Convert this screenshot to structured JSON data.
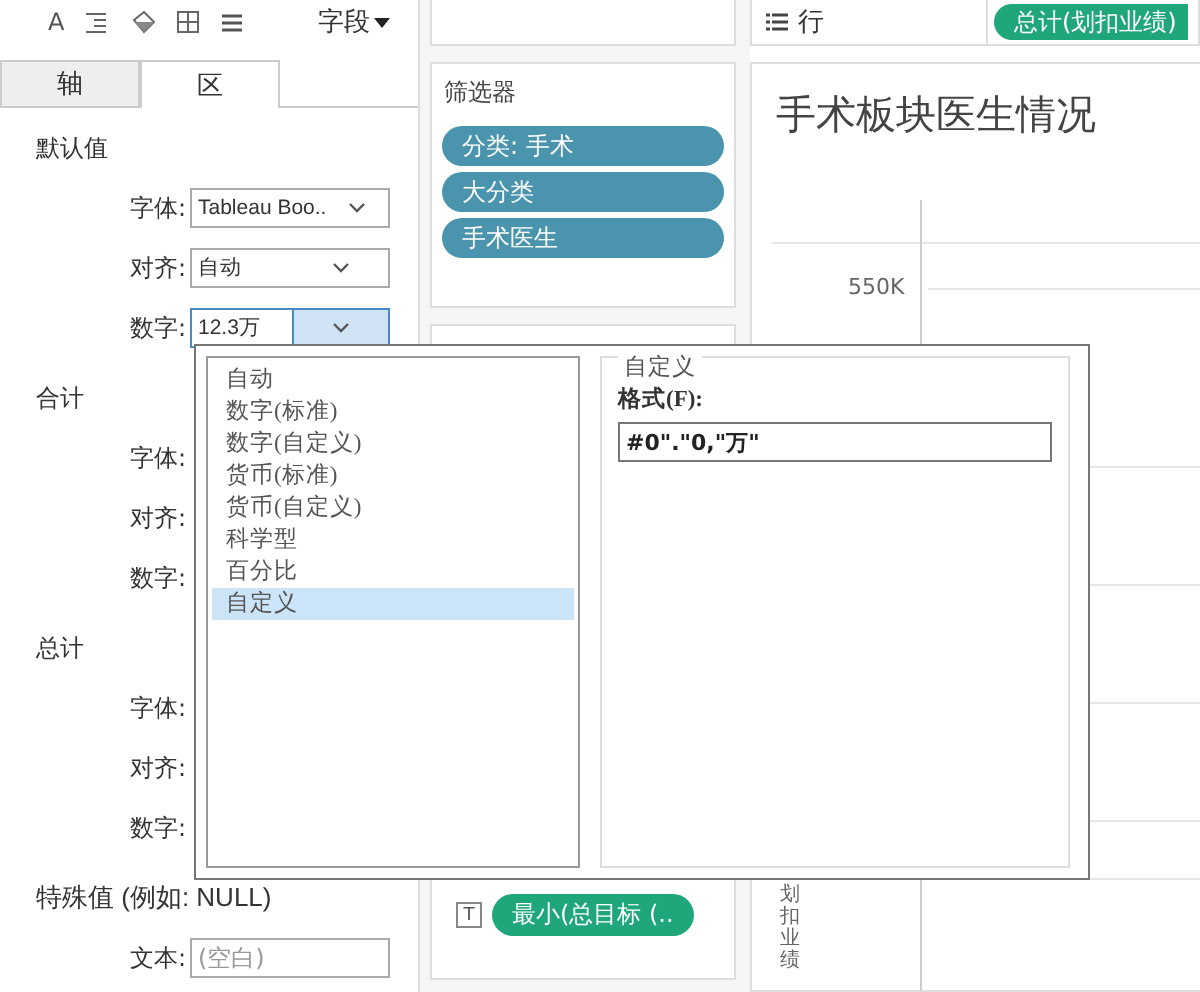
{
  "toolbar": {
    "font_glyph": "A",
    "field_menu": "字段"
  },
  "tabs": [
    {
      "label": "轴",
      "selected": false
    },
    {
      "label": "区",
      "selected": true
    }
  ],
  "sections": [
    {
      "title": "默认值",
      "rows": [
        {
          "label": "字体:",
          "value": "Tableau Boo..",
          "open": false
        },
        {
          "label": "对齐:",
          "value": "自动",
          "open": false
        },
        {
          "label": "数字:",
          "value": "12.3万",
          "open": true
        }
      ]
    },
    {
      "title": "合计",
      "rows": [
        {
          "label": "字体:"
        },
        {
          "label": "对齐:"
        },
        {
          "label": "数字:"
        }
      ]
    },
    {
      "title": "总计",
      "rows": [
        {
          "label": "字体:"
        },
        {
          "label": "对齐:"
        },
        {
          "label": "数字:"
        }
      ]
    }
  ],
  "special": {
    "title": "特殊值 (例如: NULL)",
    "text_label": "文本:",
    "placeholder": "(空白)"
  },
  "filters": {
    "title": "筛选器",
    "pills": [
      "分类: 手术",
      "大分类",
      "手术医生"
    ]
  },
  "marks": {
    "glyph": "T",
    "pill": "最小(总目标 (.."
  },
  "rows_shelf": {
    "label": "行",
    "pills": [
      "总计(划扣业绩)"
    ]
  },
  "chart": {
    "title": "手术板块医生情况",
    "tick": "550K",
    "axis_title": "划扣业绩"
  },
  "format_dialog": {
    "types": [
      {
        "label": "自动",
        "selected": false
      },
      {
        "label": "数字(标准)",
        "selected": false
      },
      {
        "label": "数字(自定义)",
        "selected": false
      },
      {
        "label": "货币(标准)",
        "selected": false
      },
      {
        "label": "货币(自定义)",
        "selected": false
      },
      {
        "label": "科学型",
        "selected": false
      },
      {
        "label": "百分比",
        "selected": false
      },
      {
        "label": "自定义",
        "selected": true
      }
    ],
    "group_title": "自定义",
    "format_label": "格式(F):",
    "value": "#0\".\"0,\"万\""
  }
}
